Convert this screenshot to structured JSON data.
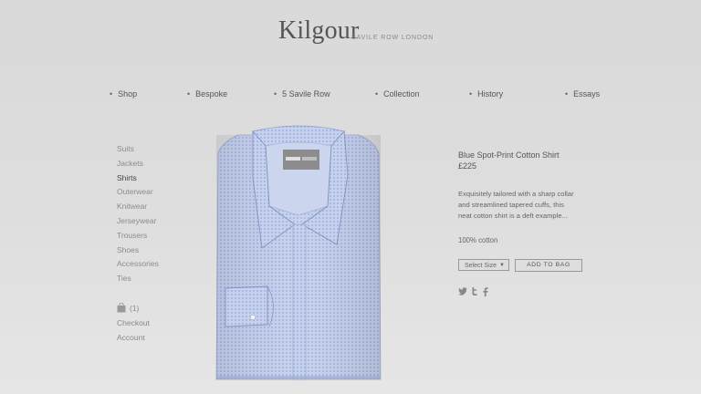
{
  "brand": {
    "name": "Kilgour",
    "tagline": "SAVILE ROW LONDON"
  },
  "nav": [
    "Shop",
    "Bespoke",
    "5 Savile Row",
    "Collection",
    "History",
    "Essays"
  ],
  "categories": [
    "Suits",
    "Jackets",
    "Shirts",
    "Outerwear",
    "Knitwear",
    "Jerseywear",
    "Trousers",
    "Shoes",
    "Accessories",
    "Ties"
  ],
  "active_category": "Shirts",
  "account": {
    "bag_count": "(1)",
    "checkout": "Checkout",
    "account": "Account"
  },
  "product": {
    "title": "Blue Spot-Print Cotton Shirt",
    "price": "£225",
    "description": [
      "Exquisitely tailored with a sharp collar",
      "and streamlined tapered cuffs, this",
      "neat cotton shirt is a deft example..."
    ],
    "material": "100% cotton",
    "size_label": "Select Size",
    "add_to_bag": "ADD TO BAG"
  },
  "social_icons": [
    "twitter-icon",
    "twitter-icon",
    "facebook-icon"
  ],
  "colors": {
    "background": "#dedede",
    "text": "#555555",
    "muted": "#8c8c8c",
    "shirt": "#b9c6e6"
  }
}
